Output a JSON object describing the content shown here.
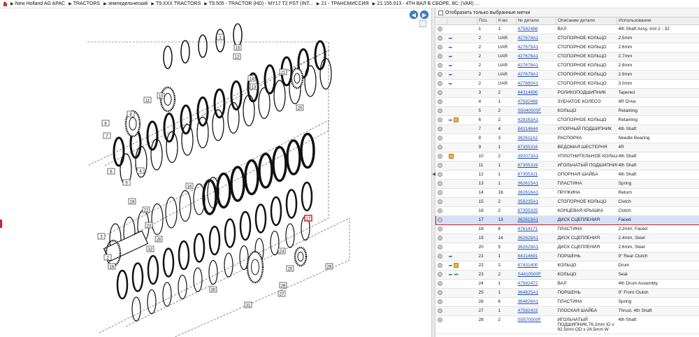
{
  "breadcrumb": [
    "New Holland AG APAC",
    "TRACTORS",
    "земледельческий",
    "T9.XXX TRACTORS",
    "T9.505 - TRACTOR (HD) - MY17 T2 PST (INT...",
    "21 - ТРАНСМИССИЯ",
    "21.155.013 - 4TH ВАЛ В СБОРЕ, 8C; (VAR) ..."
  ],
  "filter_label": "Отобразить только выбранные метки",
  "columns": [
    "Поз.",
    "К-во",
    "№ детали",
    "Описание детали",
    "Использование"
  ],
  "rows": [
    {
      "pos": "1",
      "qty": "1",
      "part": "47582468",
      "desc": "ВАЛ",
      "use": "4th Shaft Assy, Incl 2 - 32",
      "icons": []
    },
    {
      "pos": "2",
      "qty": "UAR",
      "part": "427674A1",
      "desc": "СТОПОРНОЕ КОЛЬЦО",
      "use": "2.5mm",
      "icons": [
        "swap"
      ]
    },
    {
      "pos": "2",
      "qty": "UAR",
      "part": "427675A1",
      "desc": "СТОПОРНОЕ КОЛЬЦО",
      "use": "2.6mm",
      "icons": [
        "swap"
      ]
    },
    {
      "pos": "2",
      "qty": "UAR",
      "part": "427676A1",
      "desc": "СТОПОРНОЕ КОЛЬЦО",
      "use": "2.7mm",
      "icons": [
        "swap"
      ]
    },
    {
      "pos": "2",
      "qty": "UAR",
      "part": "427678A1",
      "desc": "СТОПОРНОЕ КОЛЬЦО",
      "use": "2.8mm",
      "icons": [
        "swap"
      ]
    },
    {
      "pos": "2",
      "qty": "UAR",
      "part": "427679A1",
      "desc": "СТОПОРНОЕ КОЛЬЦО",
      "use": "2.9mm",
      "icons": [
        "swap"
      ]
    },
    {
      "pos": "2",
      "qty": "UAR",
      "part": "427680A1",
      "desc": "СТОПОРНОЕ КОЛЬЦО",
      "use": "3.0mm",
      "icons": [
        "swap"
      ]
    },
    {
      "pos": "3",
      "qty": "2",
      "part": "84314690",
      "desc": "РОЛИКОПОДШИПНИК",
      "use": "Tapered",
      "icons": []
    },
    {
      "pos": "4",
      "qty": "1",
      "part": "47582469",
      "desc": "ЗУБЧАТОЕ КОЛЕСО",
      "use": "4R Drive",
      "icons": []
    },
    {
      "pos": "5",
      "qty": "2",
      "part": "S5040500F",
      "desc": "КОЛЬЦО",
      "use": "Retaining",
      "icons": []
    },
    {
      "pos": "6",
      "qty": "2",
      "part": "428163A1",
      "desc": "СТОПОРНОЕ КОЛЬЦО",
      "use": "Retaining",
      "icons": [
        "swap",
        "box"
      ]
    },
    {
      "pos": "7",
      "qty": "4",
      "part": "84314644",
      "desc": "УПОРНЫЙ ПОДШИПНИК",
      "use": "4th Shaft",
      "icons": []
    },
    {
      "pos": "8",
      "qty": "3",
      "part": "362611A1",
      "desc": "РАСПОРКА",
      "use": "Needle Bearing",
      "icons": []
    },
    {
      "pos": "9",
      "qty": "1",
      "part": "87355316",
      "desc": "ВЕДОМАЯ ШЕСТЕРНЯ",
      "use": "4R",
      "icons": []
    },
    {
      "pos": "10",
      "qty": "2",
      "part": "392073A1",
      "desc": "УПЛОТНИТЕЛЬНОЕ КОЛЬЦ",
      "use": "4th Shaft",
      "icons": [
        "box"
      ]
    },
    {
      "pos": "11",
      "qty": "1",
      "part": "87355319",
      "desc": "ИГОЛЬЧАТЫЙ ПОДШИПНИК",
      "use": "4th Shaft",
      "icons": []
    },
    {
      "pos": "12",
      "qty": "1",
      "part": "87355321",
      "desc": "ОПОРНАЯ ШАЙБА",
      "use": "4th Shaft",
      "icons": []
    },
    {
      "pos": "13",
      "qty": "1",
      "part": "362615A1",
      "desc": "ПЛАСТИНА",
      "use": "Spring",
      "icons": []
    },
    {
      "pos": "14",
      "qty": "16",
      "part": "362616A1",
      "desc": "ПРУЖИНА",
      "use": "Return",
      "icons": []
    },
    {
      "pos": "15",
      "qty": "2",
      "part": "359235A1",
      "desc": "СТОПОРНОЕ КОЛЬЦО",
      "use": "Clutch",
      "icons": []
    },
    {
      "pos": "16",
      "qty": "2",
      "part": "87355325",
      "desc": "КОНЦЕВАЯ КРЫШКА",
      "use": "Clutch",
      "icons": []
    },
    {
      "pos": "17",
      "qty": "13",
      "part": "362619A1",
      "desc": "ДИСК СЦЕПЛЕНИЯ",
      "use": "Faced",
      "icons": [],
      "selected": true
    },
    {
      "pos": "18",
      "qty": "6",
      "part": "47614171",
      "desc": "ПЛАСТИНА",
      "use": "2.2mm, Faced",
      "icons": []
    },
    {
      "pos": "19",
      "qty": "14",
      "part": "362628A1",
      "desc": "ДИСК СЦЕПЛЕНИЯ",
      "use": "2.4mm, Steel",
      "icons": []
    },
    {
      "pos": "20",
      "qty": "5",
      "part": "362629A1",
      "desc": "ДИСК СЦЕПЛЕНИЯ",
      "use": "2.6mm, Steel",
      "icons": []
    },
    {
      "pos": "21",
      "qty": "1",
      "part": "84314691",
      "desc": "ПОРШЕНЬ",
      "use": "9\" Rear Clutch",
      "icons": [
        "swap"
      ]
    },
    {
      "pos": "22",
      "qty": "2",
      "part": "87431400",
      "desc": "КОЛЬЦО",
      "use": "Drum",
      "icons": [
        "swap",
        "box"
      ]
    },
    {
      "pos": "23",
      "qty": "2",
      "part": "S4410500F",
      "desc": "КОЛЬЦО",
      "use": "Seal",
      "icons": [
        "swap",
        "green"
      ]
    },
    {
      "pos": "24",
      "qty": "1",
      "part": "47582472",
      "desc": "ВАЛ",
      "use": "4th Drum Assembly",
      "icons": []
    },
    {
      "pos": "25",
      "qty": "1",
      "part": "364825A1",
      "desc": "ПОРШЕНЬ",
      "use": "9\" Front Clutch",
      "icons": []
    },
    {
      "pos": "26",
      "qty": "6",
      "part": "364826A1",
      "desc": "ПЛАСТИНА",
      "use": "Spring",
      "icons": []
    },
    {
      "pos": "27",
      "qty": "1",
      "part": "47582423",
      "desc": "ПЛОСКАЯ ШАЙБА",
      "use": "Thrust, 4th Shaft",
      "icons": []
    },
    {
      "pos": "28",
      "qty": "2",
      "part": "S5570500F",
      "desc": "ИГОЛЬЧАТЫЙ ПОДШИПНИК,76.2mm ID x 92.5mm OD x 24.5mm W",
      "use": "4th Shaft",
      "icons": [],
      "tall": true
    }
  ],
  "diagram": {
    "callouts": [
      "1",
      "15",
      "14",
      "13",
      "12",
      "21",
      "20",
      "11",
      "10",
      "9",
      "8",
      "7",
      "6",
      "5",
      "4",
      "3",
      "2",
      "18",
      "17",
      "19",
      "16",
      "22",
      "23",
      "26",
      "24",
      "25",
      "27",
      "28",
      "29",
      "30",
      "31",
      "32"
    ],
    "selected_callout": "17",
    "accent": "#d61f2b"
  }
}
